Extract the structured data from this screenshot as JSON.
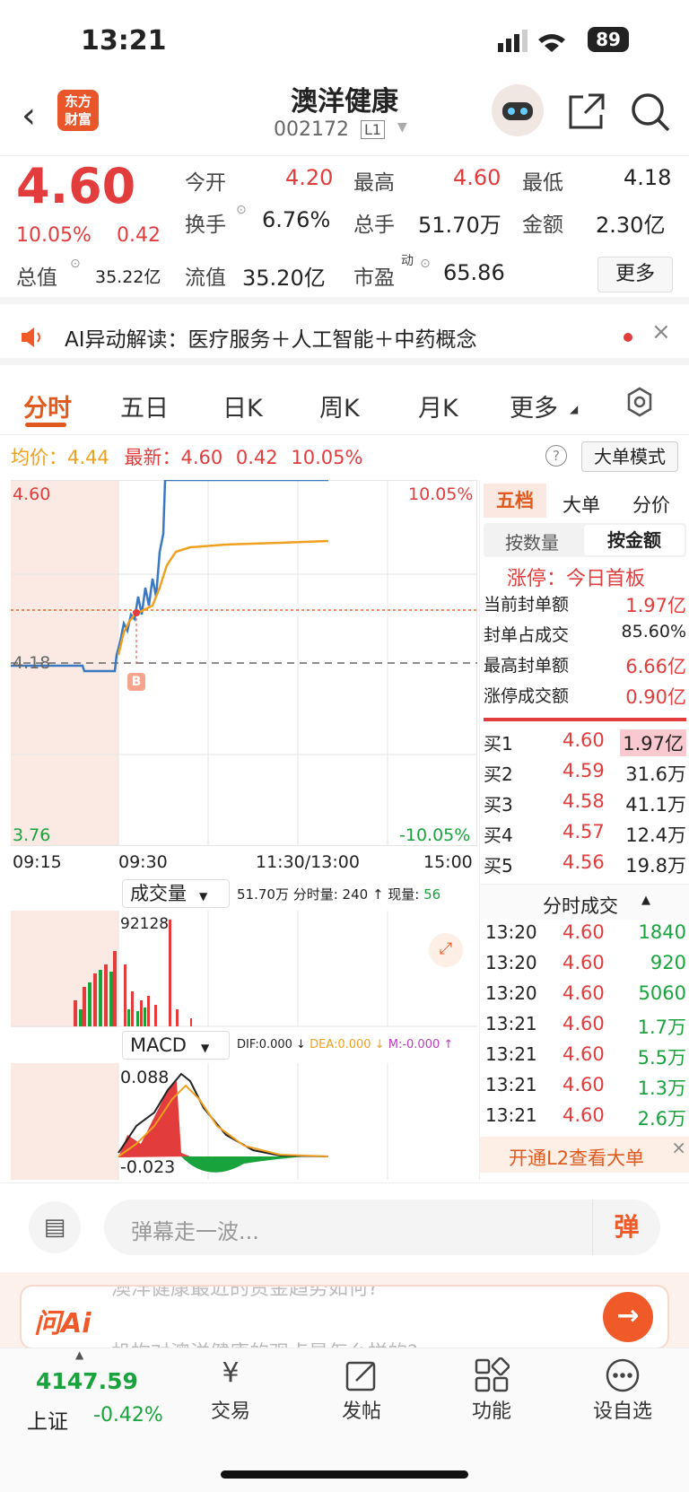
{
  "status": {
    "time": "13:21",
    "battery": "89"
  },
  "header": {
    "logo": "东方\n财富",
    "title": "澳洋健康",
    "code": "002172",
    "level": "L1"
  },
  "quote": {
    "price": "4.60",
    "pct": "10.05%",
    "chg": "0.42",
    "open_label": "今开",
    "open": "4.20",
    "high_label": "最高",
    "high": "4.60",
    "low_label": "最低",
    "low": "4.18",
    "turnover_label": "换手",
    "turnover": "6.76%",
    "vol_label": "总手",
    "vol": "51.70万",
    "amount_label": "金额",
    "amount": "2.30亿",
    "mcap_label": "总值",
    "mcap": "35.22亿",
    "float_label": "流值",
    "float": "35.20亿",
    "pe_label": "市盈",
    "pe_sup": "动",
    "pe": "65.86",
    "more": "更多"
  },
  "ai_bar": {
    "text": "AI异动解读：医疗服务＋人工智能＋中药概念"
  },
  "tabs": [
    "分时",
    "五日",
    "日K",
    "周K",
    "月K",
    "更多"
  ],
  "chart": {
    "avg_label": "均价：",
    "avg": "4.44",
    "last_label": "最新：",
    "last": "4.60",
    "chg": "0.42",
    "pct": "10.05%",
    "big_mode": "大单模式",
    "y_top": "4.60",
    "y_mid": "4.18",
    "y_bot": "3.76",
    "pct_top": "10.05%",
    "pct_bot": "-10.05%",
    "x_ticks": [
      "09:15",
      "09:30",
      "11:30/13:00",
      "15:00"
    ],
    "b_marker": "B",
    "vol_selector": "成交量",
    "vol_total": "51.70万",
    "vol_info": "分时量: 240 ↑ 现量: ",
    "vol_now": "56",
    "vol_peak": "92128",
    "macd_selector": "MACD",
    "dif": "DIF:0.000 ↓",
    "dea": "DEA:0.000 ↓",
    "m": "M:-0.000 ↑",
    "macd_top": "0.088",
    "macd_bot": "-0.023"
  },
  "side": {
    "tabs": [
      "五档",
      "大单",
      "分价"
    ],
    "subtabs": [
      "按数量",
      "按金额"
    ],
    "limit_status": "涨停：今日首板",
    "stats": [
      [
        "当前封单额",
        "1.97亿"
      ],
      [
        "封单占成交",
        "85.60%"
      ],
      [
        "最高封单额",
        "6.66亿"
      ],
      [
        "涨停成交额",
        "0.90亿"
      ]
    ],
    "bids": [
      [
        "买1",
        "4.60",
        "1.97亿"
      ],
      [
        "买2",
        "4.59",
        "31.6万"
      ],
      [
        "买3",
        "4.58",
        "41.1万"
      ],
      [
        "买4",
        "4.57",
        "12.4万"
      ],
      [
        "买5",
        "4.56",
        "19.8万"
      ]
    ],
    "ticks_title": "分时成交",
    "ticks": [
      [
        "13:20",
        "4.60",
        "1840"
      ],
      [
        "13:20",
        "4.60",
        "920"
      ],
      [
        "13:20",
        "4.60",
        "5060"
      ],
      [
        "13:21",
        "4.60",
        "1.7万"
      ],
      [
        "13:21",
        "4.60",
        "5.5万"
      ],
      [
        "13:21",
        "4.60",
        "1.3万"
      ],
      [
        "13:21",
        "4.60",
        "2.6万"
      ]
    ],
    "l2_text": "开通L2查看大单"
  },
  "danmu": {
    "placeholder": "弹幕走一波...",
    "send": "弹"
  },
  "ask_ai": {
    "logo": "问Ai",
    "line1": "澳洋健康最近的资金趋势如何?",
    "line2": "机构对澳洋健康的观点是怎么样的?"
  },
  "bottom_nav": {
    "index_value": "4147.59",
    "index_name": "上证",
    "index_chg": "-0.42%",
    "items": [
      {
        "label": "交易",
        "icon": "yen-refresh-icon"
      },
      {
        "label": "发帖",
        "icon": "edit-icon"
      },
      {
        "label": "功能",
        "icon": "grid-icon"
      },
      {
        "label": "设自选",
        "icon": "more-circle-icon"
      }
    ]
  },
  "colors": {
    "up": "#e23c3c",
    "down": "#19a33d",
    "accent": "#e05a1e",
    "avg_line": "#f0a020",
    "price_line": "#3a78c2"
  }
}
